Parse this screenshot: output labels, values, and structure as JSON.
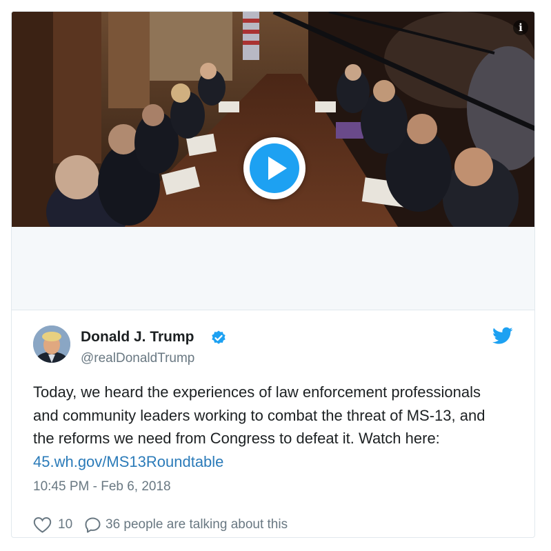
{
  "media": {
    "info_icon_glyph": "i",
    "play_icon": "play-icon"
  },
  "tweet": {
    "display_name": "Donald J. Trump",
    "handle": "@realDonaldTrump",
    "verified": true,
    "text_before_link": "Today, we heard the experiences of law enforcement professionals and community leaders working to combat the threat of MS-13, and the reforms we need from Congress to defeat it. Watch here: ",
    "link_text": "45.wh.gov/MS13Roundtable",
    "timestamp": "10:45 PM - Feb 6, 2018",
    "likes": "10",
    "talking": "36 people are talking about this"
  },
  "colors": {
    "twitter_blue": "#1da1f2",
    "link": "#2b7bb9",
    "text": "#1c2022",
    "muted": "#697882",
    "border": "#e1e8ed",
    "media_bg": "#f5f8fa"
  },
  "icons": [
    "info-icon",
    "play-icon",
    "verified-badge-icon",
    "twitter-bird-icon",
    "heart-icon",
    "reply-icon"
  ]
}
